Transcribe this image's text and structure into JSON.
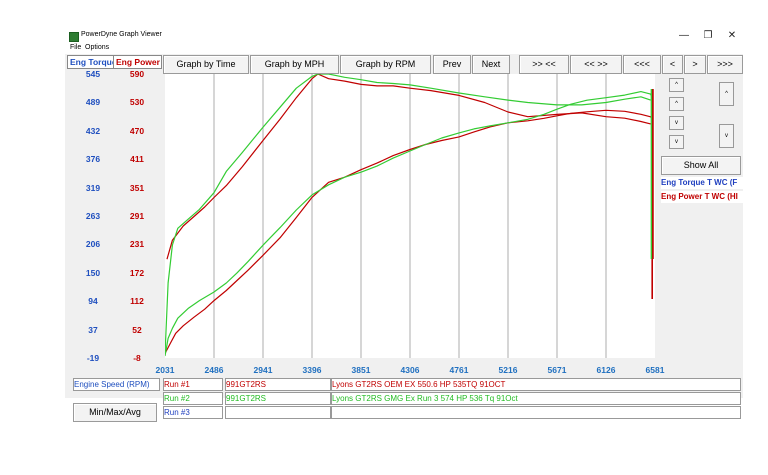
{
  "window": {
    "title": "PowerDyne Graph Viewer",
    "controls": {
      "minimize": "—",
      "restore": "❐",
      "close": "✕"
    }
  },
  "menu": {
    "file": "File",
    "options": "Options"
  },
  "axis_headers": {
    "torque": "Eng Torque",
    "power": "Eng Power"
  },
  "toolbar": {
    "graph_by_time": "Graph by Time",
    "graph_by_mph": "Graph by MPH",
    "graph_by_rpm": "Graph by RPM",
    "prev": "Prev",
    "next": "Next",
    "zoom_out": ">> <<",
    "zoom_in": "<< >>",
    "far_left": "<<<",
    "left": "<",
    "right": ">",
    "far_right": ">>>"
  },
  "side_controls": {
    "show_all": "Show All",
    "up": "^",
    "down": "v"
  },
  "legend": {
    "torque": "Eng Torque T WC (F",
    "power": "Eng Power T WC (HI"
  },
  "footer": {
    "x_axis_name": "Engine Speed (RPM)",
    "minmax_button": "Min/Max/Avg",
    "runs": [
      {
        "label": "Run #1",
        "name": "991GT2RS",
        "desc": "Lyons GT2RS OEM EX 550.6 HP 535TQ 91OCT",
        "color": "#c00000"
      },
      {
        "label": "Run #2",
        "name": "991GT2RS",
        "desc": "Lyons GT2RS GMG Ex Run 3 574 HP 536 Tq 91Oct",
        "color": "#22bb22"
      },
      {
        "label": "Run #3",
        "name": "",
        "desc": "",
        "color": "#1f3fbf"
      }
    ]
  },
  "colors": {
    "torque_axis": "#1f4fbf",
    "power_axis": "#c00000",
    "run1": "#c00000",
    "run2": "#33cc33",
    "x_axis": "#2070c0"
  },
  "chart_data": {
    "type": "line",
    "xlabel": "Engine Speed (RPM)",
    "x_ticks": [
      "2031",
      "2486",
      "2941",
      "3396",
      "3851",
      "4306",
      "4761",
      "5216",
      "5671",
      "6126",
      "6581"
    ],
    "xlim": [
      2031,
      6581
    ],
    "torque_ticks": [
      "545",
      "489",
      "432",
      "376",
      "319",
      "263",
      "206",
      "150",
      "94",
      "37",
      "-19"
    ],
    "power_ticks": [
      "590",
      "530",
      "470",
      "411",
      "351",
      "291",
      "231",
      "172",
      "112",
      "52",
      "-8"
    ],
    "torque_lim": [
      -19,
      545
    ],
    "power_lim": [
      -8,
      590
    ],
    "grid": "vertical",
    "series": [
      {
        "name": "Run #1",
        "metric": "Eng Torque",
        "axis": "torque",
        "x": [
          2031,
          2080,
          2130,
          2200,
          2300,
          2400,
          2486,
          2600,
          2700,
          2800,
          2941,
          3100,
          3250,
          3396,
          3550,
          3700,
          3851,
          4000,
          4150,
          4306,
          4450,
          4600,
          4761,
          4900,
          5050,
          5216,
          5400,
          5550,
          5671,
          5800,
          5950,
          6126,
          6300,
          6450,
          6540,
          6560
        ],
        "y": [
          -10,
          10,
          30,
          45,
          62,
          78,
          95,
          115,
          135,
          155,
          185,
          220,
          260,
          300,
          330,
          340,
          355,
          368,
          383,
          395,
          405,
          413,
          420,
          430,
          440,
          448,
          452,
          457,
          462,
          467,
          470,
          473,
          471,
          465,
          460,
          455
        ]
      },
      {
        "name": "Run #1",
        "metric": "Eng Power",
        "axis": "power",
        "x": [
          2050,
          2100,
          2200,
          2300,
          2400,
          2486,
          2600,
          2750,
          2941,
          3100,
          3250,
          3396,
          3450,
          3550,
          3700,
          3851,
          4000,
          4150,
          4306,
          4500,
          4761,
          5000,
          5216,
          5400,
          5671,
          5900,
          6126,
          6300,
          6450,
          6540
        ],
        "y": [
          200,
          240,
          270,
          290,
          310,
          330,
          355,
          395,
          450,
          495,
          540,
          580,
          590,
          580,
          575,
          568,
          565,
          565,
          560,
          555,
          545,
          530,
          510,
          500,
          505,
          508,
          500,
          497,
          490,
          485
        ]
      },
      {
        "name": "Run #2",
        "metric": "Eng Torque",
        "axis": "torque",
        "x": [
          2031,
          2060,
          2100,
          2150,
          2250,
          2350,
          2486,
          2600,
          2700,
          2800,
          2941,
          3100,
          3250,
          3396,
          3550,
          3700,
          3851,
          4000,
          4150,
          4306,
          4450,
          4600,
          4761,
          4900,
          5050,
          5216,
          5400,
          5550,
          5671,
          5800,
          5950,
          6126,
          6300,
          6450,
          6540,
          6560
        ],
        "y": [
          -15,
          20,
          40,
          60,
          80,
          95,
          112,
          130,
          150,
          172,
          205,
          240,
          275,
          305,
          325,
          340,
          350,
          362,
          378,
          392,
          405,
          418,
          428,
          436,
          442,
          448,
          455,
          465,
          475,
          485,
          493,
          498,
          503,
          510,
          505,
          495
        ]
      },
      {
        "name": "Run #2",
        "metric": "Eng Power",
        "axis": "power",
        "x": [
          2031,
          2060,
          2100,
          2150,
          2250,
          2350,
          2486,
          2600,
          2750,
          2941,
          3100,
          3250,
          3396,
          3450,
          3550,
          3700,
          3851,
          4000,
          4150,
          4306,
          4500,
          4761,
          5000,
          5216,
          5400,
          5671,
          5900,
          6126,
          6300,
          6450,
          6540
        ],
        "y": [
          0,
          150,
          230,
          265,
          285,
          305,
          340,
          385,
          425,
          478,
          520,
          560,
          585,
          590,
          590,
          583,
          578,
          572,
          570,
          567,
          560,
          550,
          542,
          535,
          530,
          525,
          525,
          530,
          537,
          542,
          535
        ]
      }
    ]
  }
}
